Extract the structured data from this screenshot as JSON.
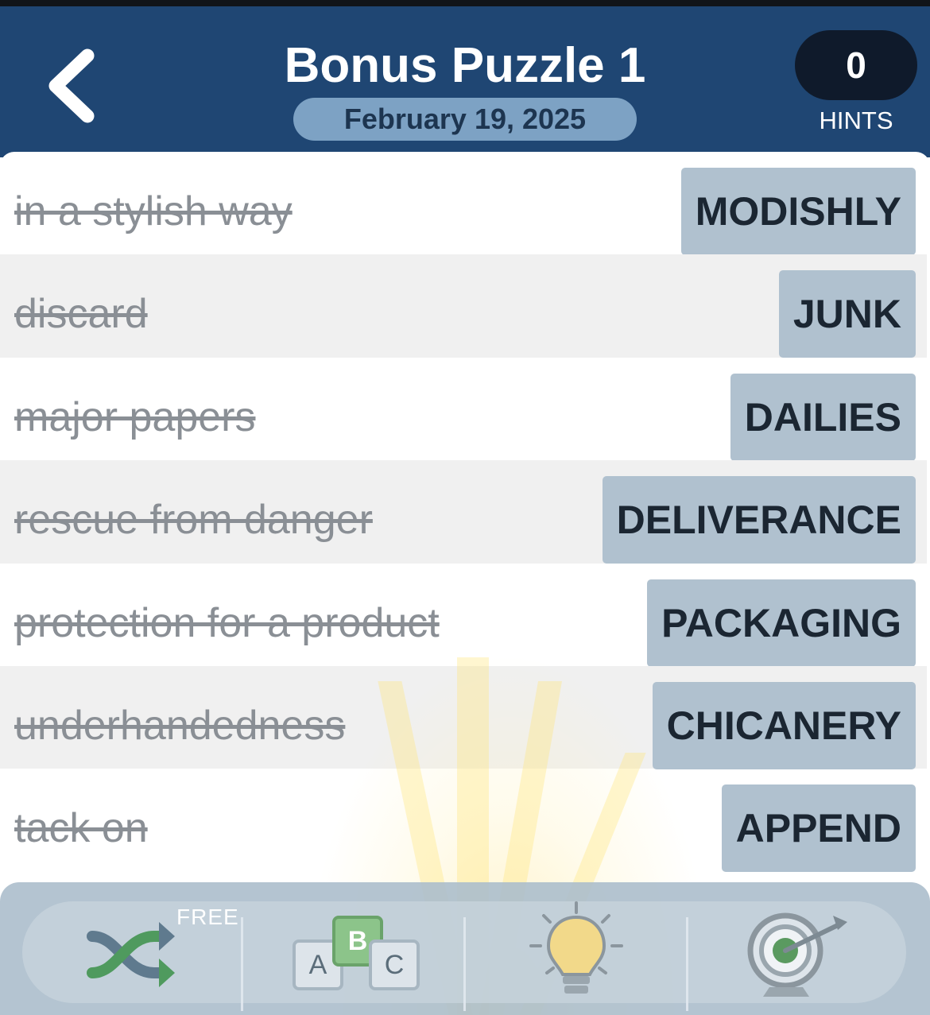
{
  "header": {
    "title": "Bonus Puzzle 1",
    "date": "February 19, 2025",
    "hints_count": "0",
    "hints_label": "HINTS"
  },
  "clues": [
    {
      "clue": "in a stylish way",
      "answer": "MODISHLY"
    },
    {
      "clue": "discard",
      "answer": "JUNK"
    },
    {
      "clue": "major papers",
      "answer": "DAILIES"
    },
    {
      "clue": "rescue from danger",
      "answer": "DELIVERANCE"
    },
    {
      "clue": "protection for a product",
      "answer": "PACKAGING"
    },
    {
      "clue": "underhandedness",
      "answer": "CHICANERY"
    },
    {
      "clue": "tack on",
      "answer": "APPEND"
    }
  ],
  "toolbar": {
    "shuffle_badge": "FREE",
    "letters": [
      "A",
      "B",
      "C"
    ],
    "icons": [
      "shuffle-icon",
      "letter-blocks-icon",
      "lightbulb-icon",
      "target-icon"
    ]
  },
  "colors": {
    "header_bg": "#1f4673",
    "date_pill": "#7da2c4",
    "answer_tile": "#b0c1cf",
    "clue_text": "#8a8f95"
  }
}
